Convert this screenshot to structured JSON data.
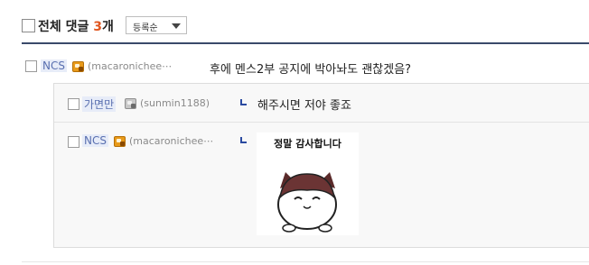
{
  "header": {
    "title_prefix": "전체 댓글",
    "count": "3",
    "count_suffix": "개",
    "sort_selected": "등록순"
  },
  "comments": [
    {
      "nickname": "NCS",
      "user_id": "(macaronichee⋯",
      "content": "후에 멘스2부 공지에 박아놔도 괜찮겠음?",
      "badge": "gold"
    }
  ],
  "replies": [
    {
      "nickname": "가면만",
      "user_id": "(sunmin1188)",
      "content": "해주시면 저야 좋죠",
      "badge": "gray"
    },
    {
      "nickname": "NCS",
      "user_id": "(macaronichee⋯",
      "sticker_text": "정말 감사합니다",
      "badge": "gold"
    }
  ],
  "colors": {
    "count": "#e0561f",
    "nickname": "#5a70b0",
    "reply_arrow": "#2a4aa0",
    "header_rule": "#3a4a6a"
  },
  "icons": [
    "user-level-badge-icon",
    "reply-arrow-icon",
    "dropdown-arrow-icon"
  ]
}
